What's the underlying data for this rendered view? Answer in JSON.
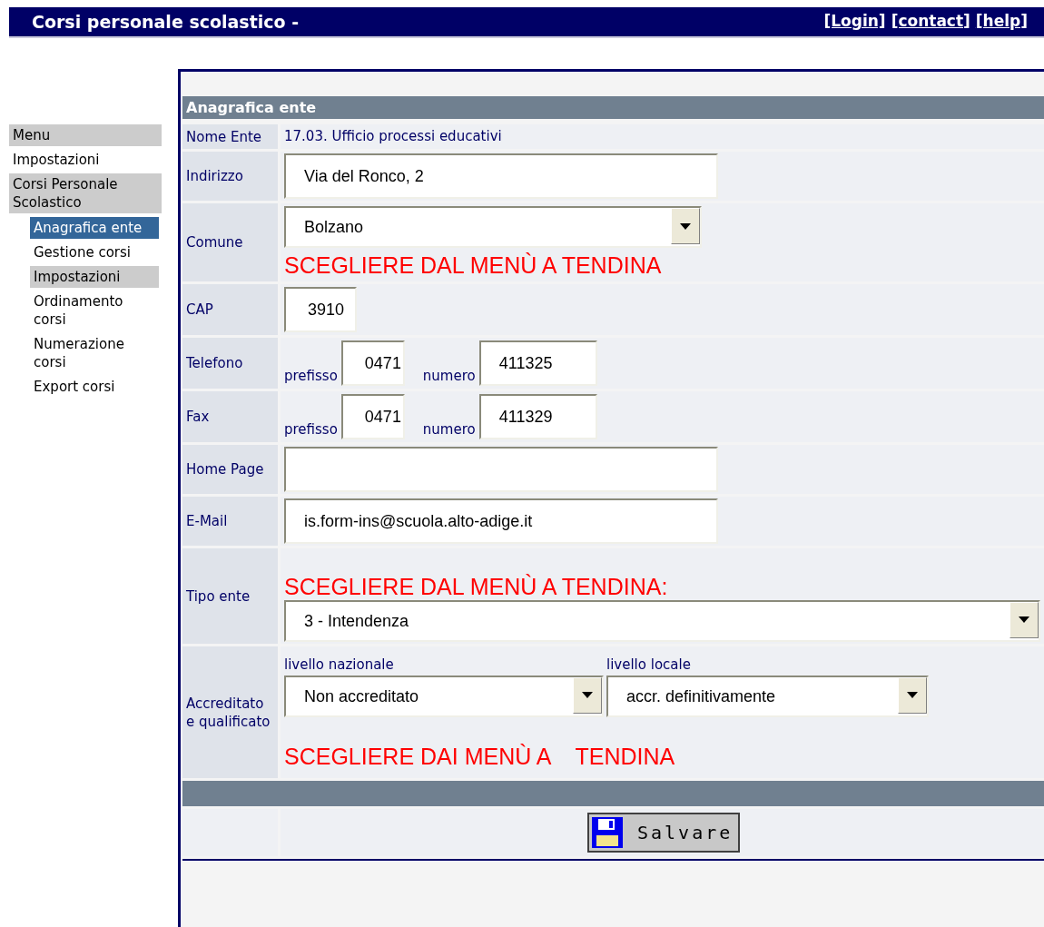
{
  "header": {
    "title": "Corsi personale scolastico -",
    "links": [
      "[Login]",
      "[contact]",
      "[help]"
    ]
  },
  "sidebar": {
    "items": [
      {
        "label": "Menu",
        "kind": "heading",
        "selected": false
      },
      {
        "label": "Impostazioni",
        "kind": "link",
        "selected": false
      },
      {
        "label": "Corsi Personale Scolastico",
        "kind": "heading",
        "selected": false,
        "children": [
          {
            "label": "Anagrafica ente",
            "kind": "link",
            "selected": true
          },
          {
            "label": "Gestione corsi",
            "kind": "link",
            "selected": false
          },
          {
            "label": "Impostazioni",
            "kind": "heading",
            "selected": false
          },
          {
            "label": "Ordinamento corsi",
            "kind": "link",
            "selected": false
          },
          {
            "label": "Numerazione corsi",
            "kind": "link",
            "selected": false
          },
          {
            "label": "Export corsi",
            "kind": "link",
            "selected": false
          }
        ]
      }
    ]
  },
  "form": {
    "title": "Anagrafica ente",
    "rows": [
      {
        "label": "Nome Ente",
        "kind": "text",
        "value": "17.03. Ufficio processi educativi"
      },
      {
        "label": "Indirizzo",
        "kind": "input",
        "value": "Via del Ronco, 2"
      },
      {
        "label": "Comune",
        "kind": "select",
        "value": "Bolzano",
        "note": "SCEGLIERE DAL MENÙ A TENDINA"
      },
      {
        "label": "CAP",
        "kind": "short_input",
        "value": "3910"
      },
      {
        "label": "Telefono",
        "kind": "phone",
        "prefix_label": "prefisso",
        "prefix": "0471",
        "number_label": "numero",
        "number": "411325"
      },
      {
        "label": "Fax",
        "kind": "phone",
        "prefix_label": "prefisso",
        "prefix": "0471",
        "number_label": "numero",
        "number": "411329"
      },
      {
        "label": "Home Page",
        "kind": "input",
        "value": ""
      },
      {
        "label": "E-Mail",
        "kind": "input",
        "value": "is.form-ins@scuola.alto-adige.it"
      },
      {
        "label": "Tipo ente",
        "kind": "choice",
        "note": "SCEGLIERE DAL MENÙ A TENDINA:",
        "value": "3 - Intendenza"
      },
      {
        "label": "Accreditato e qualificato",
        "kind": "accreditation",
        "national_label": "livello nazionale",
        "national": "Non accreditato",
        "local_label": "livello locale",
        "local": "accr. definitivamente",
        "note": "SCEGLIERE DAI MENÙ A    TENDINA"
      }
    ],
    "save_button": "Salvare"
  }
}
